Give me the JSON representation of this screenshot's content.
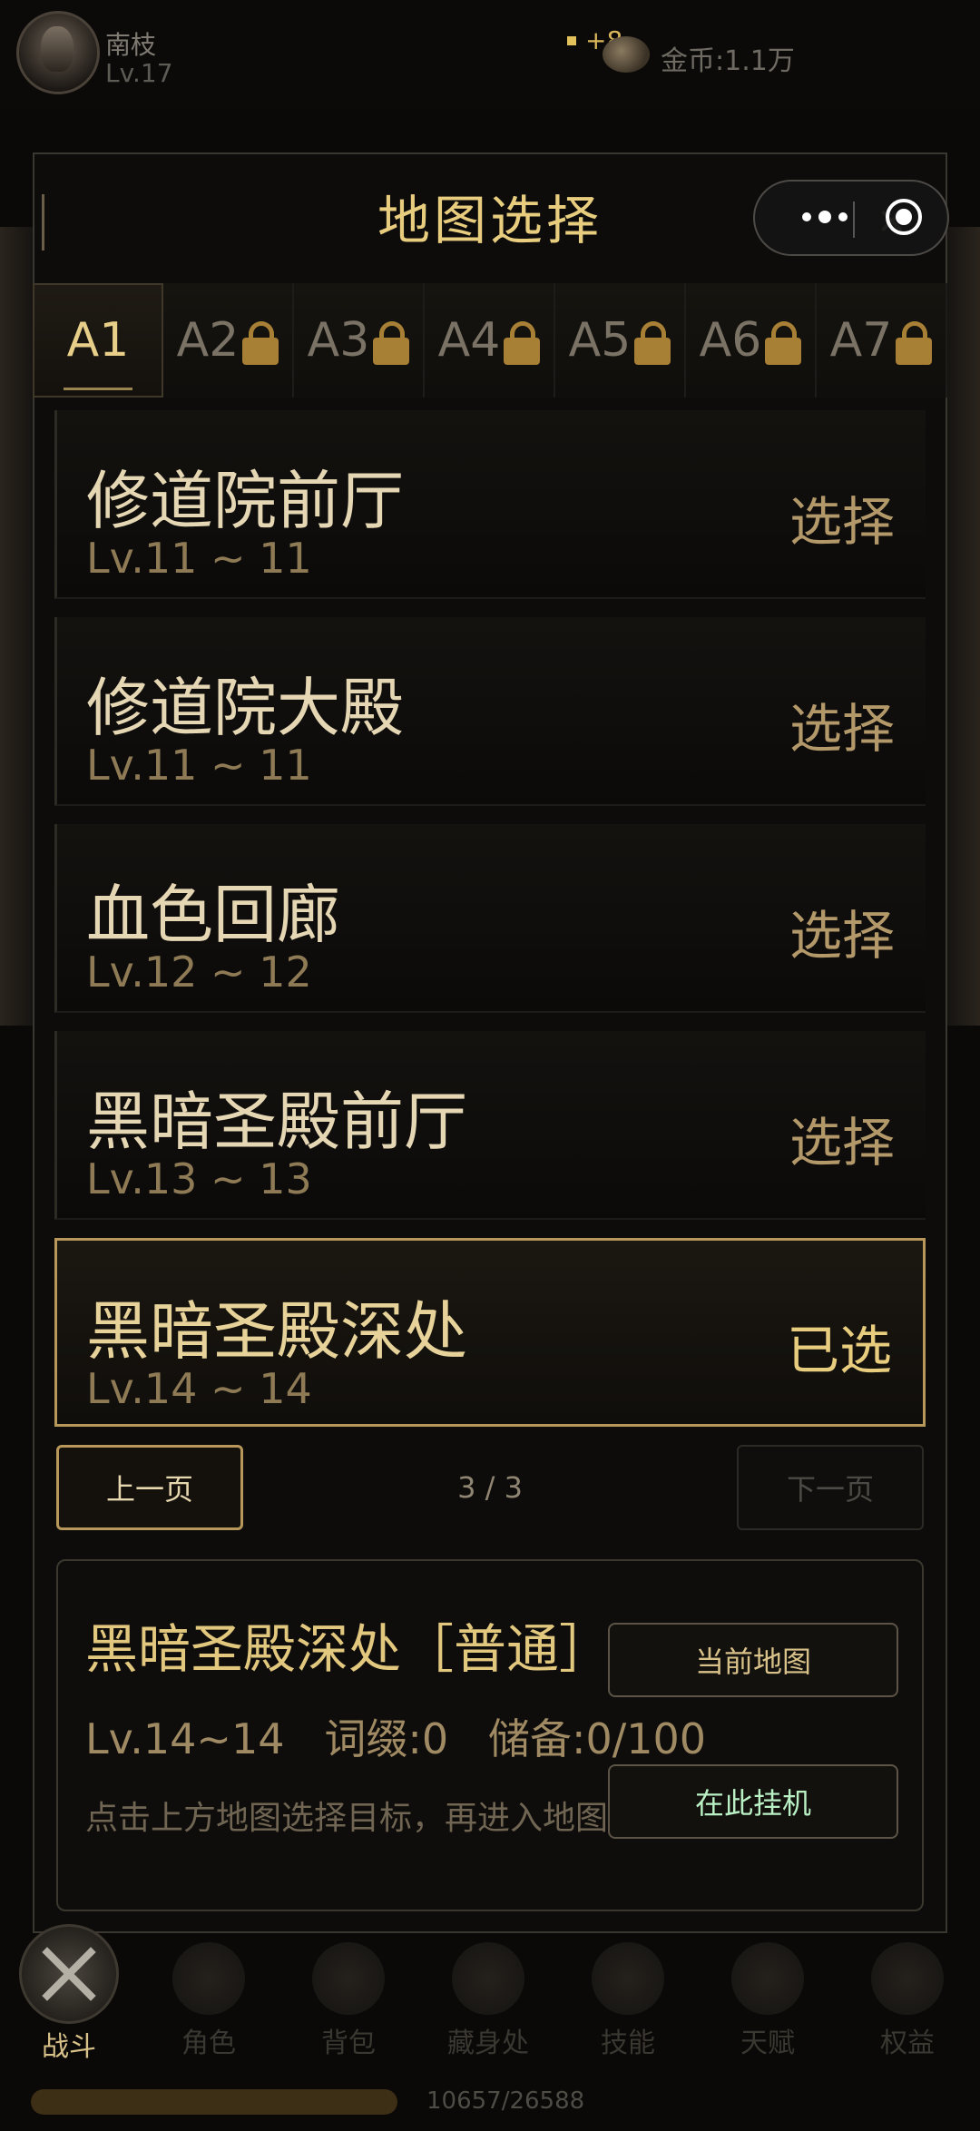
{
  "player": {
    "name": "南枝",
    "level": "Lv.17",
    "bonus": "+8",
    "gold": "金币:1.1万"
  },
  "modal": {
    "title": "地图选择"
  },
  "tabs": [
    {
      "label": "A1",
      "locked": false
    },
    {
      "label": "A2",
      "locked": true
    },
    {
      "label": "A3",
      "locked": true
    },
    {
      "label": "A4",
      "locked": true
    },
    {
      "label": "A5",
      "locked": true
    },
    {
      "label": "A6",
      "locked": true
    },
    {
      "label": "A7",
      "locked": true
    }
  ],
  "maps": [
    {
      "name": "修道院前厅",
      "level": "Lv.11 ~ 11",
      "action": "选择"
    },
    {
      "name": "修道院大殿",
      "level": "Lv.11 ~ 11",
      "action": "选择"
    },
    {
      "name": "血色回廊",
      "level": "Lv.12 ~ 12",
      "action": "选择"
    },
    {
      "name": "黑暗圣殿前厅",
      "level": "Lv.13 ~ 13",
      "action": "选择"
    },
    {
      "name": "黑暗圣殿深处",
      "level": "Lv.14 ~ 14",
      "action": "已选"
    }
  ],
  "pager": {
    "prev": "上一页",
    "indicator": "3 / 3",
    "next": "下一页"
  },
  "info": {
    "title": "黑暗圣殿深处［普通］",
    "stats": "Lv.14~14   词缀:0   储备:0/100",
    "hint": "点击上方地图选择目标，再进入地图开始挂机",
    "current_button": "当前地图",
    "idle_button": "在此挂机"
  },
  "nav": [
    {
      "label": "战斗",
      "icon": "crossed-swords-icon"
    },
    {
      "label": "角色",
      "icon": "character-icon"
    },
    {
      "label": "背包",
      "icon": "bag-icon"
    },
    {
      "label": "藏身处",
      "icon": "hideout-icon"
    },
    {
      "label": "技能",
      "icon": "skill-book-icon"
    },
    {
      "label": "天赋",
      "icon": "talent-icon"
    },
    {
      "label": "权益",
      "icon": "crown-icon"
    }
  ],
  "xp": {
    "text": "10657/26588",
    "fraction": 0.4008
  },
  "colors": {
    "accent": "#e8cd7e",
    "selected_border": "#b7985a",
    "idle_text": "#b9f0c4"
  }
}
